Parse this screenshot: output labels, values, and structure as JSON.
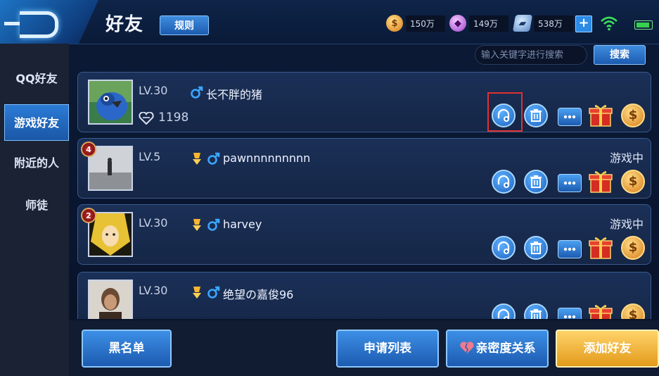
{
  "header": {
    "title": "好友",
    "rules_label": "规则",
    "currencies": [
      {
        "icon": "coin-icon",
        "value": "150万"
      },
      {
        "icon": "diamond-icon",
        "value": "149万"
      },
      {
        "icon": "voucher-icon",
        "value": "538万"
      }
    ]
  },
  "search": {
    "placeholder": "输入关键字进行搜索",
    "button_label": "搜索"
  },
  "sidebar": {
    "items": [
      {
        "label": "QQ好友",
        "active": false
      },
      {
        "label": "游戏好友",
        "active": true
      },
      {
        "label": "附近的人",
        "active": false
      },
      {
        "label": "师徒",
        "active": false
      }
    ]
  },
  "friends": [
    {
      "level": "LV.30",
      "name": "长不胖的猪",
      "hearts": "1198",
      "status": "",
      "rank": ""
    },
    {
      "level": "LV.5",
      "name": "pawnnnnnnnnn",
      "hearts": "",
      "status": "游戏中",
      "rank": "4"
    },
    {
      "level": "LV.30",
      "name": "harvey",
      "hearts": "",
      "status": "游戏中",
      "rank": "2"
    },
    {
      "level": "LV.30",
      "name": "绝望の嘉俊96",
      "hearts": "",
      "status": "",
      "rank": ""
    }
  ],
  "footer": {
    "blacklist_label": "黑名单",
    "requests_label": "申请列表",
    "intimacy_label": "亲密度关系",
    "add_label": "添加好友"
  },
  "colors": {
    "accent_blue": "#2b7cd6",
    "highlight_red": "#e23030",
    "gold": "#e39a1a"
  }
}
